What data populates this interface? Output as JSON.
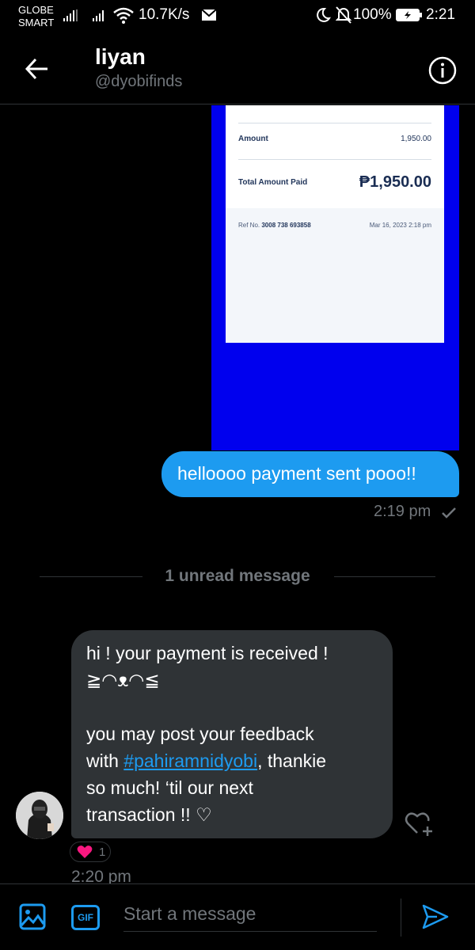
{
  "status_bar": {
    "carrier_line1": "GLOBE",
    "carrier_line2": "SMART",
    "net_speed": "10.7K/s",
    "battery": "100%",
    "time": "2:21"
  },
  "header": {
    "name": "liyan",
    "handle": "@dyobifinds"
  },
  "receipt": {
    "amount_label": "Amount",
    "amount_value": "1,950.00",
    "total_label": "Total Amount Paid",
    "total_value": "₱1,950.00",
    "ref_label": "Ref No.",
    "ref_value": "3008 738 693858",
    "date": "Mar 16, 2023 2:18 pm"
  },
  "sent_message": {
    "text": "helloooo payment sent pooo!!",
    "time": "2:19 pm"
  },
  "unread_divider": "1 unread message",
  "received_message": {
    "line1": "hi ! your payment is received !",
    "line2": "≧◠ᴥ◠≦",
    "line3": "you may post your feedback",
    "line4_pre": "with ",
    "hashtag": "#pahiramnidyobi",
    "line4_post": ", thankie",
    "line5": "so much! ‘til our next",
    "line6": "transaction !! ♡",
    "reaction_count": "1",
    "time": "2:20 pm"
  },
  "composer": {
    "gif_label": "GIF",
    "placeholder": "Start a message"
  },
  "colors": {
    "accent": "#1d9bf0",
    "received_bubble": "#2f3336",
    "muted_text": "#71767b",
    "receipt_background": "#0000ee"
  }
}
